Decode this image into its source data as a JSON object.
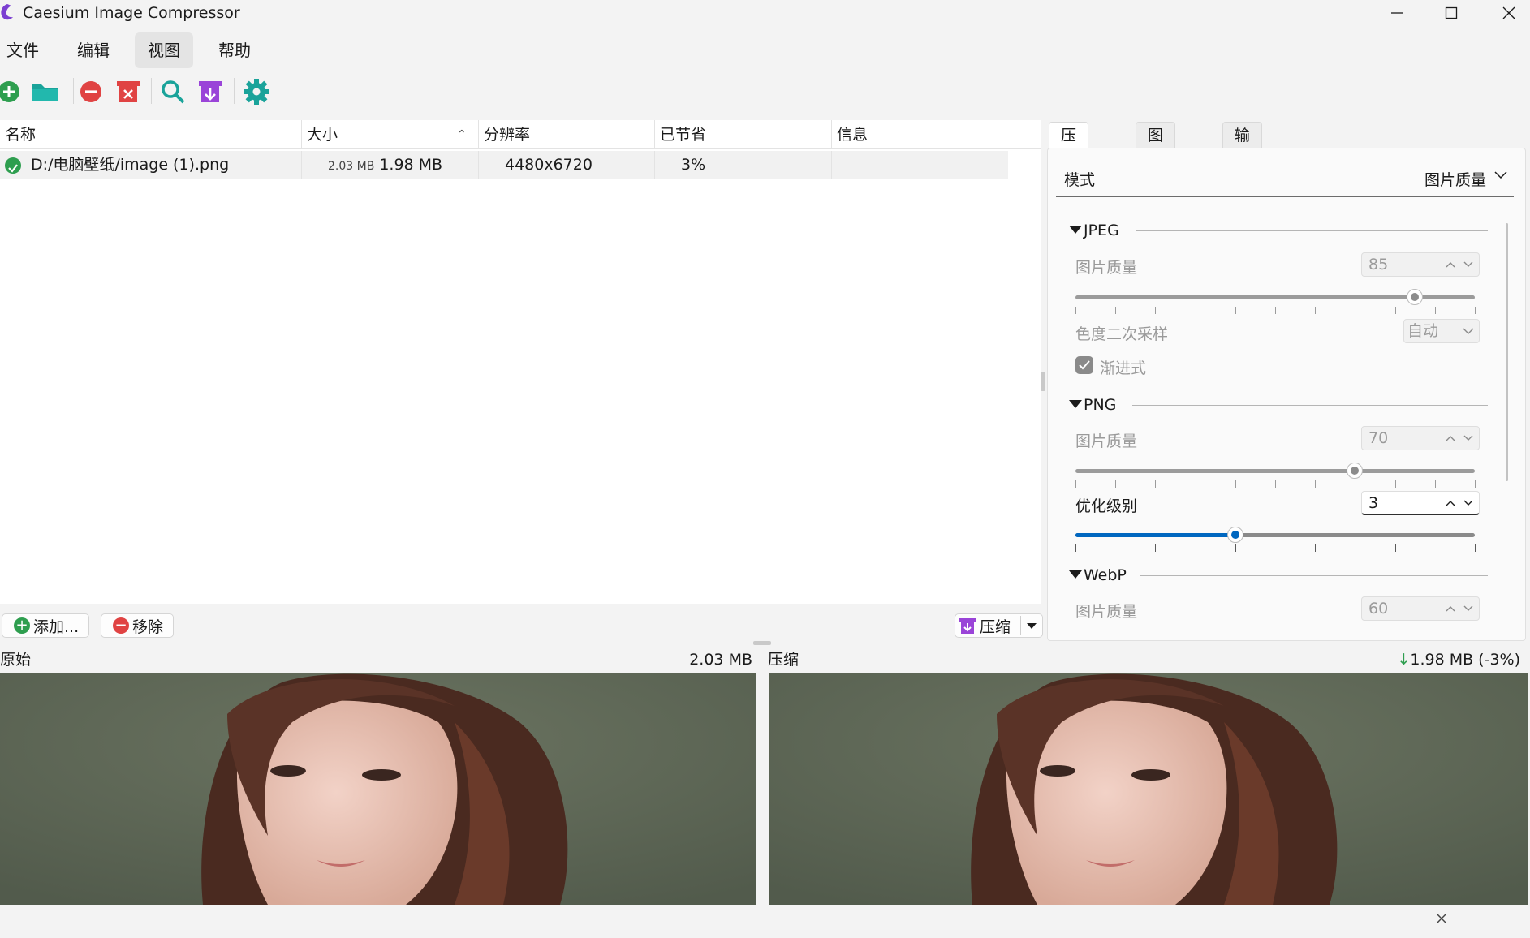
{
  "window": {
    "title": "Caesium Image Compressor"
  },
  "menu": [
    {
      "label": "文件"
    },
    {
      "label": "编辑"
    },
    {
      "label": "视图"
    },
    {
      "label": "帮助"
    }
  ],
  "toolbar": {
    "icons": [
      "add-icon",
      "open-folder-icon",
      "remove-icon",
      "clear-list-icon",
      "preview-search-icon",
      "compress-icon",
      "settings-icon"
    ]
  },
  "list": {
    "columns": [
      "名称",
      "大小",
      "分辨率",
      "已节省",
      "信息"
    ],
    "rows": [
      {
        "name": "D:/电脑壁纸/image (1).png",
        "original_size": "2.03 MB",
        "size": "1.98 MB",
        "resolution": "4480x6720",
        "saved": "3%",
        "info": ""
      }
    ]
  },
  "buttons": {
    "add": "添加...",
    "remove": "移除",
    "compress": "压缩"
  },
  "preview": {
    "original_label": "原始",
    "original_size": "2.03 MB",
    "compressed_label": "压缩",
    "compressed_size": "1.98 MB (-3%)",
    "arrow": "↓"
  },
  "tabs": [
    "压缩选项",
    "图片尺寸",
    "输出"
  ],
  "options": {
    "mode_label": "模式",
    "mode_value": "图片质量",
    "jpeg": {
      "title": "JPEG",
      "quality_label": "图片质量",
      "quality": "85",
      "quality_fraction": 0.85,
      "chroma_label": "色度二次采样",
      "chroma_value": "自动",
      "progressive_label": "渐进式",
      "progressive": true
    },
    "png": {
      "title": "PNG",
      "quality_label": "图片质量",
      "quality": "70",
      "quality_fraction": 0.7,
      "opt_label": "优化级别",
      "opt_level": "3",
      "opt_fraction": 0.4
    },
    "webp": {
      "title": "WebP",
      "quality_label": "图片质量",
      "quality": "60"
    }
  },
  "colors": {
    "accent": "#0067c0",
    "green": "#2e9e4f",
    "red": "#e04343",
    "purple": "#9a44d8",
    "teal": "#1aa39a"
  }
}
